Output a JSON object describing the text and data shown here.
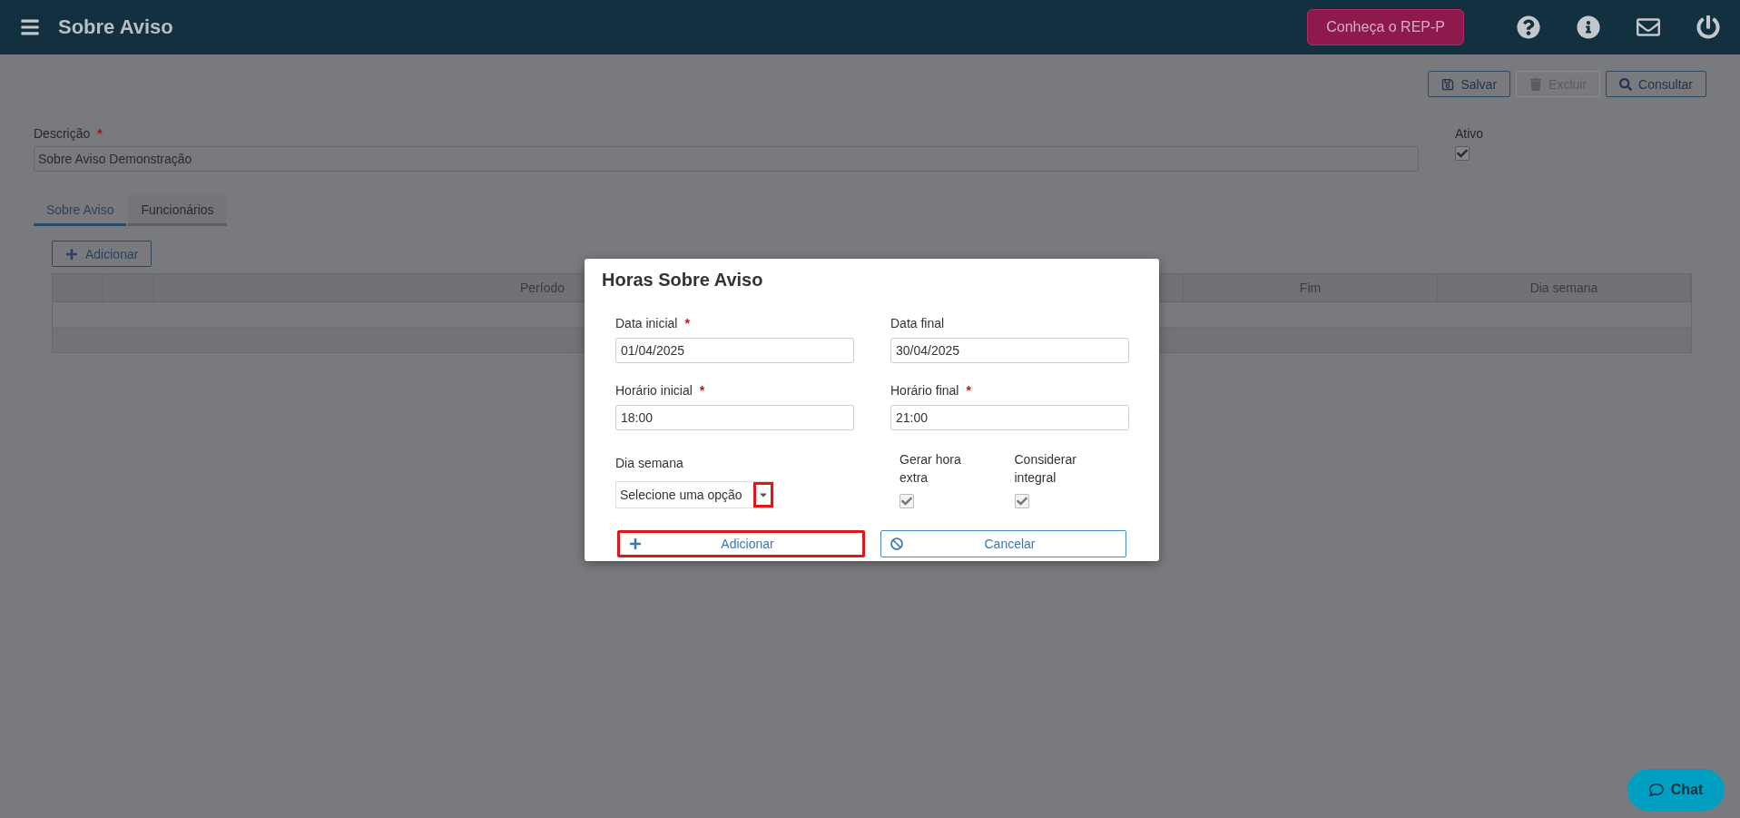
{
  "header": {
    "title": "Sobre Aviso",
    "promo_button": "Conheça o REP-P"
  },
  "toolbar": [
    {
      "label": "Salvar",
      "disabled": false
    },
    {
      "label": "Excluir",
      "disabled": true
    },
    {
      "label": "Consultar",
      "disabled": false
    }
  ],
  "form": {
    "description": {
      "label": "Descrição",
      "required_mark": "*",
      "value": "Sobre Aviso Demonstração"
    },
    "active": {
      "label": "Ativo",
      "checked": true
    }
  },
  "tabs": [
    {
      "label": "Sobre Aviso",
      "selected": true
    },
    {
      "label": "Funcionários",
      "selected": false
    }
  ],
  "add_button": "Adicionar",
  "table": {
    "columns": [
      "Período",
      "Fim",
      "Dia semana"
    ]
  },
  "modal": {
    "title": "Horas Sobre Aviso",
    "fields": [
      {
        "label": "Data inicial",
        "required_mark": "*",
        "value": "01/04/2025"
      },
      {
        "label": "Data final",
        "value": "30/04/2025"
      },
      {
        "label": "Horário inicial",
        "required_mark": "*",
        "value": "18:00"
      },
      {
        "label": "Horário final",
        "required_mark": "*",
        "value": "21:00"
      }
    ],
    "weekday": {
      "label": "Dia semana",
      "placeholder": "Selecione uma opção",
      "highlighted": true
    },
    "checkboxes": [
      {
        "label": "Gerar hora extra",
        "checked": true
      },
      {
        "label": "Considerar integral",
        "checked": true
      }
    ],
    "buttons": [
      {
        "kind": "add",
        "label": "Adicionar",
        "highlighted": true
      },
      {
        "kind": "cancel",
        "label": "Cancelar",
        "highlighted": false
      }
    ]
  },
  "chat_button": "Chat"
}
